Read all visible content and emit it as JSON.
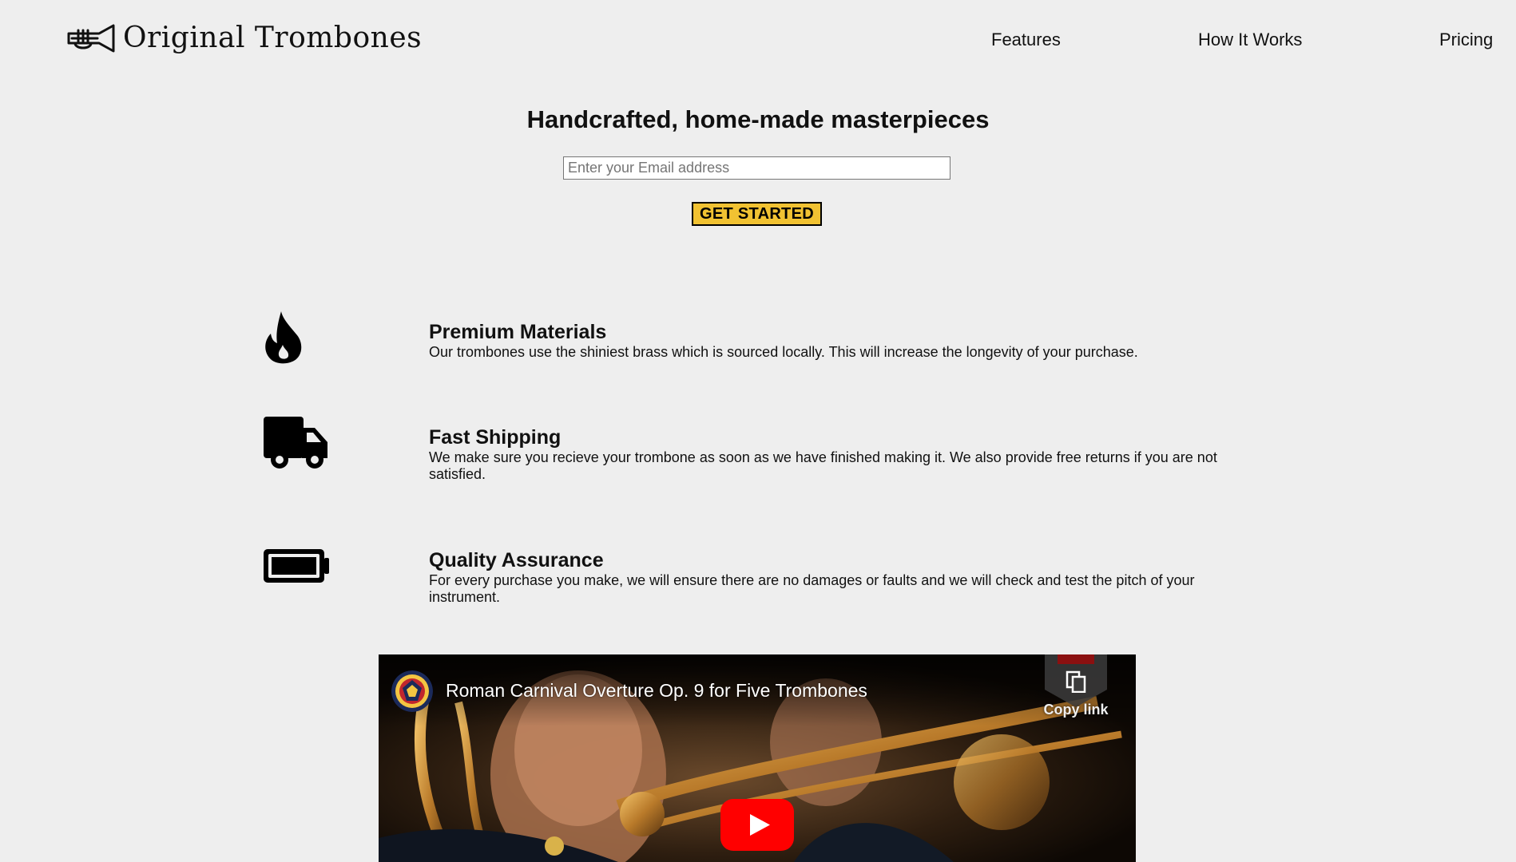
{
  "header": {
    "brand_name": "Original Trombones",
    "logo_icon": "trumpet-icon",
    "nav": [
      {
        "label": "Features"
      },
      {
        "label": "How It Works"
      },
      {
        "label": "Pricing"
      }
    ]
  },
  "hero": {
    "title": "Handcrafted, home-made masterpieces",
    "email_placeholder": "Enter your Email address",
    "email_value": "",
    "cta_label": "GET STARTED",
    "cta_color": "#f1c232"
  },
  "features": [
    {
      "icon": "fire-icon",
      "title": "Premium Materials",
      "description": "Our trombones use the shiniest brass which is sourced locally. This will increase the longevity of your purchase."
    },
    {
      "icon": "truck-icon",
      "title": "Fast Shipping",
      "description": "We make sure you recieve your trombone as soon as we have finished making it. We also provide free returns if you are not satisfied."
    },
    {
      "icon": "battery-full-icon",
      "title": "Quality Assurance",
      "description": "For every purchase you make, we will ensure there are no damages or faults and we will check and test the pitch of your instrument."
    }
  ],
  "video": {
    "title": "Roman Carnival Overture Op. 9 for Five Trombones",
    "copy_link_label": "Copy link",
    "play_icon": "youtube-play-icon",
    "play_color": "#ff0000"
  }
}
